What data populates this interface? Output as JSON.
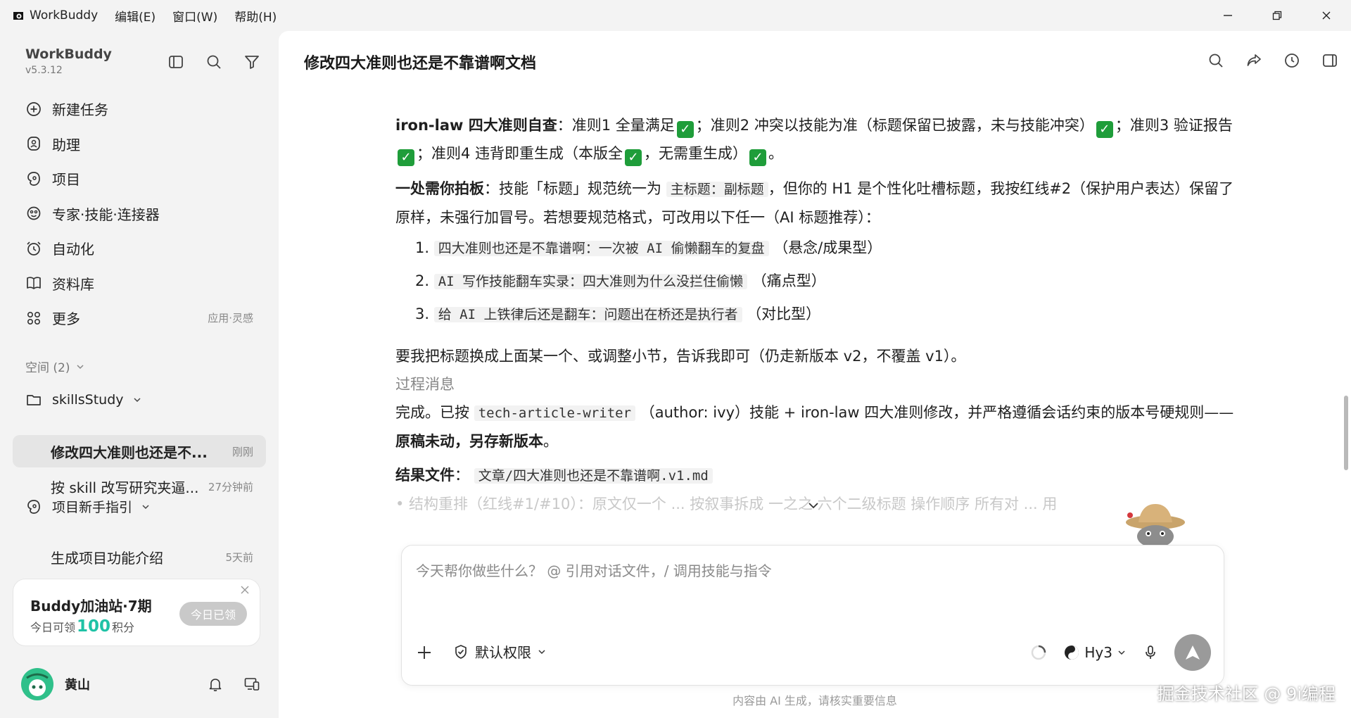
{
  "titlebar": {
    "app_name": "WorkBuddy",
    "menus": [
      "编辑(E)",
      "窗口(W)",
      "帮助(H)"
    ]
  },
  "sidebar": {
    "brand_name": "WorkBuddy",
    "version": "v5.3.12",
    "nav": [
      {
        "label": "新建任务",
        "icon": "new-task-icon"
      },
      {
        "label": "助理",
        "icon": "assistant-icon"
      },
      {
        "label": "项目",
        "icon": "project-icon"
      },
      {
        "label": "专家·技能·连接器",
        "icon": "expert-icon"
      },
      {
        "label": "自动化",
        "icon": "alarm-icon"
      },
      {
        "label": "资料库",
        "icon": "book-icon"
      },
      {
        "label": "更多",
        "icon": "grid-icon",
        "extra": "应用·灵感"
      }
    ],
    "space_label": "空间 (2)",
    "project1": "skillsStudy",
    "tasks": [
      {
        "label": "修改四大准则也还是不...",
        "time": "刚刚"
      },
      {
        "label": "按 skill 改写研究夹逼...",
        "time": "27分钟前"
      }
    ],
    "project2": "项目新手指引",
    "task3": {
      "label": "生成项目功能介绍",
      "time": "5天前"
    },
    "promo": {
      "title": "Buddy加油站·7期",
      "sub_prefix": "今日可领",
      "points": "100",
      "sub_suffix": "积分",
      "button": "今日已领"
    },
    "user_name": "黄山"
  },
  "main": {
    "title": "修改四大准则也还是不靠谱啊文档",
    "p1": {
      "bold": "iron-law 四大准则自查",
      "t1": "：准则1 全量满足",
      "t2": "；准则2 冲突以技能为准（标题保留已披露，未与技能冲突）",
      "t3": "；准则3 验证报告",
      "t4": "；准则4 违背即重生成（本版全",
      "t5": "，无需重生成）",
      "t6": "。"
    },
    "p2": {
      "bold": "一处需你拍板",
      "t1": "：技能「标题」规范统一为",
      "code": "主标题：副标题",
      "t2": "，但你的 H1 是个性化吐槽标题，我按红线#2（保护用户表达）保留了原样，未强行加冒号。若想要规范格式，可改用以下任一（AI 标题推荐）："
    },
    "options": [
      {
        "num": "1.",
        "code": "四大准则也还是不靠谱啊：一次被 AI 偷懒翻车的复盘",
        "note": "（悬念/成果型）"
      },
      {
        "num": "2.",
        "code": "AI 写作技能翻车实录：四大准则为什么没拦住偷懒",
        "note": "（痛点型）"
      },
      {
        "num": "3.",
        "code": "给 AI 上铁律后还是翻车：问题出在桥还是执行者",
        "note": "（对比型）"
      }
    ],
    "p3": "要我把标题换成上面某一个、或调整小节，告诉我即可（仍走新版本 v2，不覆盖 v1）。",
    "process_label": "过程消息",
    "p4": {
      "t1": "完成。已按",
      "code": "tech-article-writer",
      "t2": "（author: ivy）技能 + iron-law 四大准则修改，并严格遵循会话约束的版本号硬规则——",
      "bold": "原稿未动，另存新版本",
      "t3": "。"
    },
    "result": {
      "bold": "结果文件",
      "sep": "：",
      "code": "文章/四大准则也还是不靠谱啊.v1.md"
    },
    "faded_line": "• 结构重排（红线#1/#10）：原文仅一个 ... 按叙事拆成 一之之 六个二级标题 操作顺序 所有对 ... 用"
  },
  "composer": {
    "placeholder": "今天帮你做些什么？ @ 引用对话文件，/ 调用技能与指令",
    "permission": "默认权限",
    "model": "Hy3"
  },
  "disclaimer": "内容由 AI 生成，请核实重要信息",
  "watermark": "掘金技术社区 @ 9i编程",
  "colors": {
    "accent": "#1fc2a6",
    "check": "#1f9d3a"
  }
}
